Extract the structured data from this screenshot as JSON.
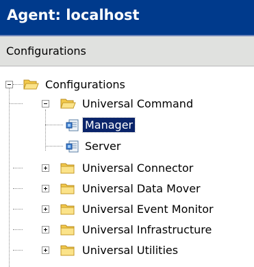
{
  "window": {
    "title": "Agent: localhost"
  },
  "section": {
    "title": "Configurations"
  },
  "tree": {
    "root": {
      "label": "Configurations",
      "icon": "folder-open-icon",
      "state": "expanded"
    },
    "universal_command": {
      "label": "Universal Command",
      "icon": "folder-open-icon",
      "state": "expanded"
    },
    "manager": {
      "label": "Manager",
      "icon": "config-page-icon",
      "selected": true
    },
    "server": {
      "label": "Server",
      "icon": "config-page-icon",
      "selected": false
    },
    "universal_connector": {
      "label": "Universal Connector",
      "icon": "folder-icon",
      "state": "collapsed"
    },
    "universal_data_mover": {
      "label": "Universal Data Mover",
      "icon": "folder-icon",
      "state": "collapsed"
    },
    "universal_event_monitor": {
      "label": "Universal Event Monitor",
      "icon": "folder-icon",
      "state": "collapsed"
    },
    "universal_infrastructure": {
      "label": "Universal Infrastructure",
      "icon": "folder-icon",
      "state": "collapsed"
    },
    "universal_utilities": {
      "label": "Universal Utilities",
      "icon": "folder-icon",
      "state": "collapsed"
    }
  },
  "colors": {
    "title_bar": "#003a8c",
    "section_header": "#e0e1df",
    "selection": "#0a246a"
  }
}
